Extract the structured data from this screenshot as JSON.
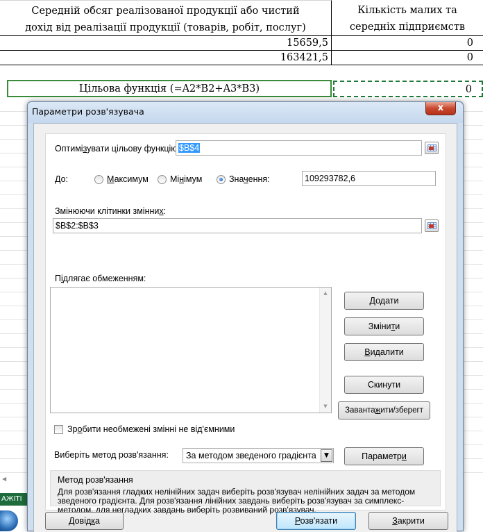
{
  "sheet": {
    "header": {
      "col_a_line1": "Середній обсяг реалізованої продукції або чистий",
      "col_a_line2": "дохід від реалізації продукції (товарів, робіт, послуг)",
      "col_b_line1": "Кількість малих та",
      "col_b_line2": "середніх підприємств"
    },
    "rows": [
      {
        "a": "15659,5",
        "b": "0"
      },
      {
        "a": "163421,5",
        "b": "0"
      }
    ],
    "objective_label": "Цільова функція (=A2*B2+A3*B3)",
    "objective_value": "0",
    "taskbar_text": "АЖІТІ"
  },
  "dialog": {
    "title": "Параметри розв'язувача",
    "close_label": "x",
    "objective": {
      "label_pre": "Оптимі",
      "label_ul": "з",
      "label_post": "увати цільову функцію:",
      "ref": "$B$4"
    },
    "to": {
      "label": "До:",
      "max_ul": "М",
      "max_rest": "аксимум",
      "min_pre": "Мі",
      "min_ul": "н",
      "min_post": "імум",
      "value_pre": "Зна",
      "value_ul": "ч",
      "value_post": "ення:",
      "selected": "value",
      "value": "109293782,6"
    },
    "variables": {
      "label_pre": "Змінюючи клітинки змінни",
      "label_ul": "х",
      "label_post": ":",
      "ref": "$B$2:$B$3"
    },
    "constraints": {
      "label_pre": "П",
      "label_ul": "і",
      "label_post": "длягає обмеженням:",
      "items": []
    },
    "buttons": {
      "add_ul": "Д",
      "add_rest": "одати",
      "change_pre": "Зміни",
      "change_ul": "т",
      "change_post": "и",
      "delete_ul": "В",
      "delete_rest": "идалити",
      "reset": "Скинути",
      "loadsave_pre": "Заванта",
      "loadsave_ul": "ж",
      "loadsave_post": "ити/зберегт",
      "options_pre": "Параметр",
      "options_ul": "и",
      "help_pre": "Довід",
      "help_ul": "к",
      "help_post": "а",
      "solve_ul": "Р",
      "solve_rest": "озв'язати",
      "close_ul": "З",
      "close_rest": "акрити"
    },
    "nonneg": {
      "pre": "Зр",
      "ul": "о",
      "post": "бити необмежені змінні не від'ємними",
      "checked": false
    },
    "method": {
      "label": "Виберіть метод розв'язання:",
      "selected": "За методом зведеного градієнта",
      "group_title": "Метод розв'язання",
      "description": "Для розв'язання гладких нелінійних задач виберіть розв'язувач нелінійних задач за методом зведеного градієнта. Для розв'язання лінійних завдань виберіть розв'язувач за симплекс-методом, для негладких завдань виберіть розвиваний розв'язувач."
    }
  }
}
